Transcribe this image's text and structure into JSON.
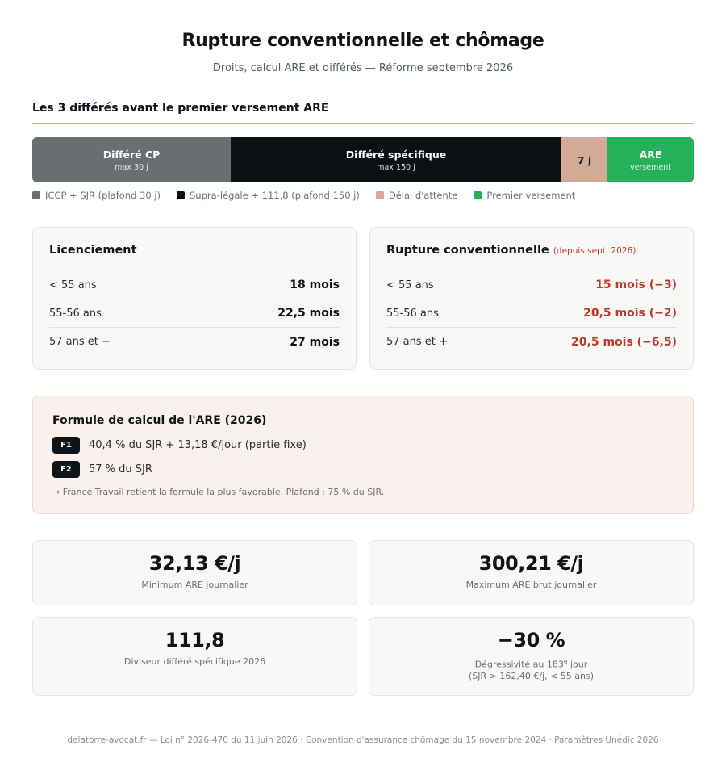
{
  "header": {
    "title": "Rupture conventionnelle et chômage",
    "subtitle": "Droits, calcul ARE et différés — Réforme septembre 2026"
  },
  "differes": {
    "section_title": "Les 3 différés avant le premier versement ARE",
    "segments": [
      {
        "label": "Différé CP",
        "sub": "max 30 j",
        "color": "#6b6e71"
      },
      {
        "label": "Différé spécifique",
        "sub": "max 150 j",
        "color": "#0c1014"
      },
      {
        "label": "7 j",
        "color": "#d3a998"
      },
      {
        "label": "ARE",
        "sub": "versement",
        "color": "#27b05a"
      }
    ],
    "legend": [
      {
        "label": "ICCP ÷ SJR (plafond 30 j)",
        "color": "#6b6e71"
      },
      {
        "label": "Supra-légale ÷ 111,8 (plafond 150 j)",
        "color": "#0c1014"
      },
      {
        "label": "Délai d'attente",
        "color": "#d3a998"
      },
      {
        "label": "Premier versement",
        "color": "#27b05a"
      }
    ]
  },
  "licenciement": {
    "title": "Licenciement",
    "rows": [
      {
        "age": "< 55 ans",
        "value": "18 mois"
      },
      {
        "age": "55-56 ans",
        "value": "22,5 mois"
      },
      {
        "age": "57 ans et +",
        "value": "27 mois"
      }
    ]
  },
  "rupture": {
    "title": "Rupture conventionnelle",
    "note": "(depuis sept. 2026)",
    "rows": [
      {
        "age": "< 55 ans",
        "value": "15 mois (−3)"
      },
      {
        "age": "55-56 ans",
        "value": "20,5 mois (−2)"
      },
      {
        "age": "57 ans et +",
        "value": "20,5 mois (−6,5)"
      }
    ]
  },
  "formula": {
    "title": "Formule de calcul de l'ARE (2026)",
    "f1_badge": "F1",
    "f1_text": "40,4 % du SJR + 13,18 €/jour (partie fixe)",
    "f2_badge": "F2",
    "f2_text": "57 % du SJR",
    "note": "→ France Travail retient la formule la plus favorable. Plafond : 75 % du SJR."
  },
  "stats": {
    "min_value": "32,13 €/j",
    "min_label": "Minimum ARE journalier",
    "max_value": "300,21 €/j",
    "max_label": "Maximum ARE brut journalier",
    "divisor_value": "111,8",
    "divisor_label": "Diviseur différé spécifique 2026",
    "degress_value": "−30 %",
    "degress_label_prefix": "Dégressivité au 183",
    "degress_label_sup": "e",
    "degress_label_suffix": " jour",
    "degress_label_line2": "(SJR > 162,40 €/j, < 55 ans)"
  },
  "footer": {
    "text": "delatorre-avocat.fr — Loi n° 2026-470 du 11 juin 2026 · Convention d'assurance chômage du 15 novembre 2024 · Paramètres Unédic 2026"
  }
}
